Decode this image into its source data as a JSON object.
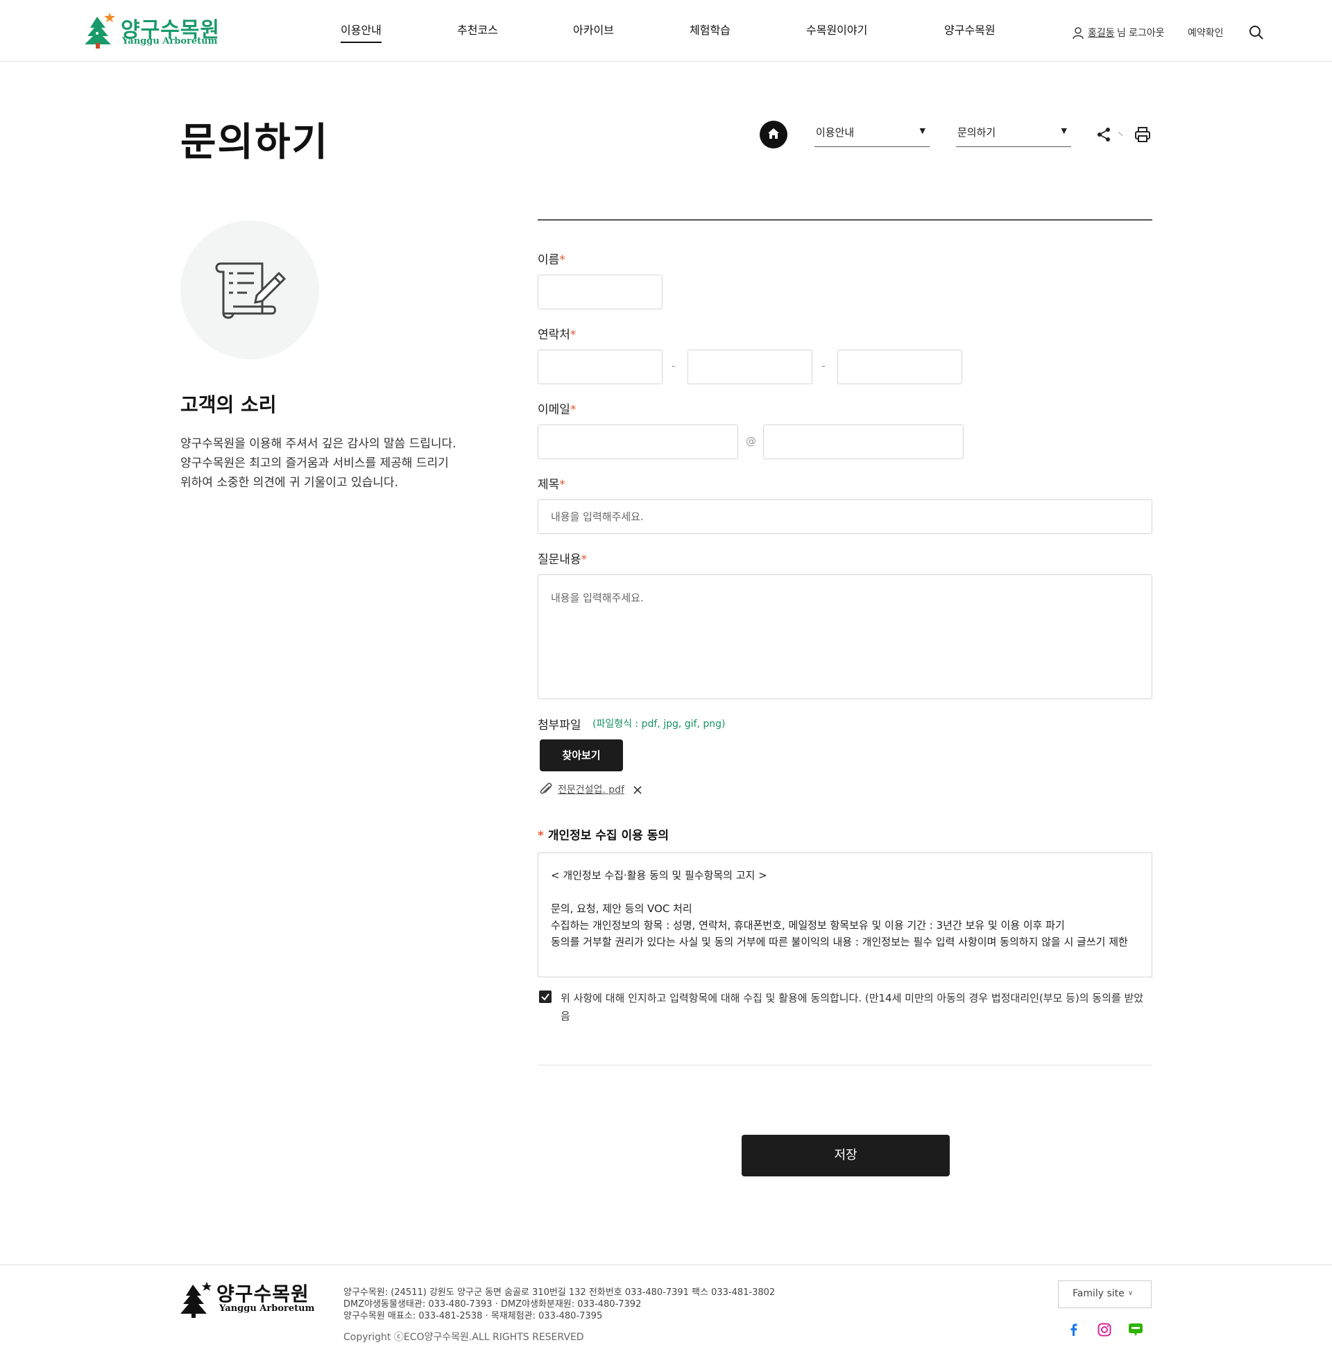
{
  "header": {
    "logo_ko": "양구수목원",
    "logo_en": "Yanggu Arboretum",
    "nav": [
      "이용안내",
      "추천코스",
      "아카이브",
      "체험학습",
      "수목원이야기",
      "양구수목원"
    ],
    "user_name": "홍길동",
    "user_suffix": "님",
    "logout": "로그아웃",
    "reservation": "예약확인"
  },
  "page": {
    "title": "문의하기",
    "breadcrumb": [
      "이용안내",
      "문의하기"
    ]
  },
  "left": {
    "title": "고객의 소리",
    "desc": [
      "양구수목원을 이용해 주셔서 깊은 감사의 말씀 드립니다.",
      "양구수목원은 최고의 즐거움과 서비스를 제공해 드리기",
      "위하여 소중한 의견에 귀 기울이고 있습니다."
    ]
  },
  "form": {
    "required_mark": "*",
    "name_label": "이름",
    "phone_label": "연락처",
    "phone_sep": "-",
    "email_label": "이메일",
    "email_at": "@",
    "subject_label": "제목",
    "subject_placeholder": "내용을 입력해주세요.",
    "content_label": "질문내용",
    "content_placeholder": "내용을 입력해주세요.",
    "attach_label": "첨부파일",
    "attach_hint": "(파일형식 : pdf, jpg, gif, png)",
    "browse": "찾아보기",
    "attached_file": "전문건설업. pdf",
    "privacy_title": "개인정보 수집 이용 동의",
    "privacy_lines": [
      "< 개인정보 수집·활용 동의 및 필수항목의 고지 >",
      "",
      "문의, 요청, 제안 등의 VOC 처리",
      "수집하는 개인정보의 항목 : 성명, 연락처, 휴대폰번호, 메일정보 항목보유 및 이용 기간 : 3년간 보유 및 이용 이후 파기",
      "동의를 거부할 권리가 있다는 사실 및 동의 거부에 따른 불이익의 내용 : 개인정보는 필수 입력 사항이며 동의하지 않을 시 글쓰기 제한"
    ],
    "agree_text": "위 사항에 대해 인지하고 입력항목에 대해 수집 및 활용에 동의합니다. (만14세 미만의 아동의 경우 법정대리인(부모 등)의 동의를 받았음",
    "agree_checked": true,
    "save": "저장"
  },
  "footer": {
    "logo_ko": "양구수목원",
    "logo_en": "Yanggu Arboretum",
    "address_lines": [
      "양구수목원: (24511) 강원도 양구군 동면 숨골로 310번길 132 전화번호 033-480-7391 팩스 033-481-3802",
      "DMZ야생동물생태관: 033-480-7393 · DMZ야생화분재원: 033-480-7392",
      "양구수목원 매표소: 033-481-2538 · 목재체험관: 033-480-7395"
    ],
    "copyright": "Copyright ⓒECO양구수목원.ALL RIGHTS RESERVED",
    "family_site": "Family site",
    "social": [
      "facebook-icon",
      "instagram-icon",
      "blog-icon"
    ],
    "colors": {
      "brand": "#1a9a6a",
      "accent": "#e4572e",
      "facebook": "#1877f2",
      "instagram": "#d6249f",
      "blog": "#2db400"
    }
  }
}
